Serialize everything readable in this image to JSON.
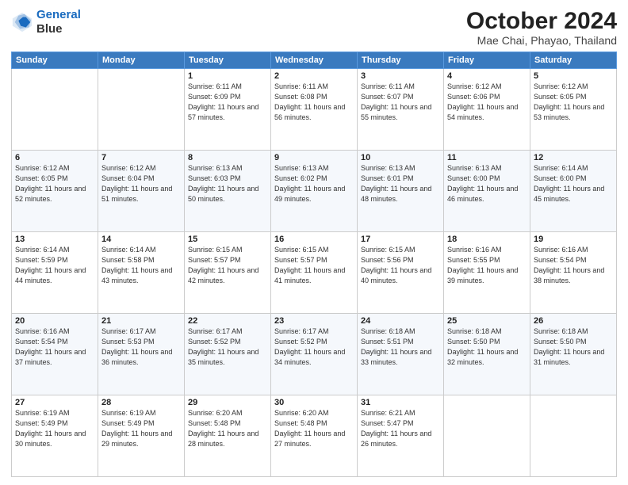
{
  "header": {
    "logo_line1": "General",
    "logo_line2": "Blue",
    "title": "October 2024",
    "subtitle": "Mae Chai, Phayao, Thailand"
  },
  "weekdays": [
    "Sunday",
    "Monday",
    "Tuesday",
    "Wednesday",
    "Thursday",
    "Friday",
    "Saturday"
  ],
  "weeks": [
    [
      {
        "day": "",
        "sunrise": "",
        "sunset": "",
        "daylight": ""
      },
      {
        "day": "",
        "sunrise": "",
        "sunset": "",
        "daylight": ""
      },
      {
        "day": "1",
        "sunrise": "Sunrise: 6:11 AM",
        "sunset": "Sunset: 6:09 PM",
        "daylight": "Daylight: 11 hours and 57 minutes."
      },
      {
        "day": "2",
        "sunrise": "Sunrise: 6:11 AM",
        "sunset": "Sunset: 6:08 PM",
        "daylight": "Daylight: 11 hours and 56 minutes."
      },
      {
        "day": "3",
        "sunrise": "Sunrise: 6:11 AM",
        "sunset": "Sunset: 6:07 PM",
        "daylight": "Daylight: 11 hours and 55 minutes."
      },
      {
        "day": "4",
        "sunrise": "Sunrise: 6:12 AM",
        "sunset": "Sunset: 6:06 PM",
        "daylight": "Daylight: 11 hours and 54 minutes."
      },
      {
        "day": "5",
        "sunrise": "Sunrise: 6:12 AM",
        "sunset": "Sunset: 6:05 PM",
        "daylight": "Daylight: 11 hours and 53 minutes."
      }
    ],
    [
      {
        "day": "6",
        "sunrise": "Sunrise: 6:12 AM",
        "sunset": "Sunset: 6:05 PM",
        "daylight": "Daylight: 11 hours and 52 minutes."
      },
      {
        "day": "7",
        "sunrise": "Sunrise: 6:12 AM",
        "sunset": "Sunset: 6:04 PM",
        "daylight": "Daylight: 11 hours and 51 minutes."
      },
      {
        "day": "8",
        "sunrise": "Sunrise: 6:13 AM",
        "sunset": "Sunset: 6:03 PM",
        "daylight": "Daylight: 11 hours and 50 minutes."
      },
      {
        "day": "9",
        "sunrise": "Sunrise: 6:13 AM",
        "sunset": "Sunset: 6:02 PM",
        "daylight": "Daylight: 11 hours and 49 minutes."
      },
      {
        "day": "10",
        "sunrise": "Sunrise: 6:13 AM",
        "sunset": "Sunset: 6:01 PM",
        "daylight": "Daylight: 11 hours and 48 minutes."
      },
      {
        "day": "11",
        "sunrise": "Sunrise: 6:13 AM",
        "sunset": "Sunset: 6:00 PM",
        "daylight": "Daylight: 11 hours and 46 minutes."
      },
      {
        "day": "12",
        "sunrise": "Sunrise: 6:14 AM",
        "sunset": "Sunset: 6:00 PM",
        "daylight": "Daylight: 11 hours and 45 minutes."
      }
    ],
    [
      {
        "day": "13",
        "sunrise": "Sunrise: 6:14 AM",
        "sunset": "Sunset: 5:59 PM",
        "daylight": "Daylight: 11 hours and 44 minutes."
      },
      {
        "day": "14",
        "sunrise": "Sunrise: 6:14 AM",
        "sunset": "Sunset: 5:58 PM",
        "daylight": "Daylight: 11 hours and 43 minutes."
      },
      {
        "day": "15",
        "sunrise": "Sunrise: 6:15 AM",
        "sunset": "Sunset: 5:57 PM",
        "daylight": "Daylight: 11 hours and 42 minutes."
      },
      {
        "day": "16",
        "sunrise": "Sunrise: 6:15 AM",
        "sunset": "Sunset: 5:57 PM",
        "daylight": "Daylight: 11 hours and 41 minutes."
      },
      {
        "day": "17",
        "sunrise": "Sunrise: 6:15 AM",
        "sunset": "Sunset: 5:56 PM",
        "daylight": "Daylight: 11 hours and 40 minutes."
      },
      {
        "day": "18",
        "sunrise": "Sunrise: 6:16 AM",
        "sunset": "Sunset: 5:55 PM",
        "daylight": "Daylight: 11 hours and 39 minutes."
      },
      {
        "day": "19",
        "sunrise": "Sunrise: 6:16 AM",
        "sunset": "Sunset: 5:54 PM",
        "daylight": "Daylight: 11 hours and 38 minutes."
      }
    ],
    [
      {
        "day": "20",
        "sunrise": "Sunrise: 6:16 AM",
        "sunset": "Sunset: 5:54 PM",
        "daylight": "Daylight: 11 hours and 37 minutes."
      },
      {
        "day": "21",
        "sunrise": "Sunrise: 6:17 AM",
        "sunset": "Sunset: 5:53 PM",
        "daylight": "Daylight: 11 hours and 36 minutes."
      },
      {
        "day": "22",
        "sunrise": "Sunrise: 6:17 AM",
        "sunset": "Sunset: 5:52 PM",
        "daylight": "Daylight: 11 hours and 35 minutes."
      },
      {
        "day": "23",
        "sunrise": "Sunrise: 6:17 AM",
        "sunset": "Sunset: 5:52 PM",
        "daylight": "Daylight: 11 hours and 34 minutes."
      },
      {
        "day": "24",
        "sunrise": "Sunrise: 6:18 AM",
        "sunset": "Sunset: 5:51 PM",
        "daylight": "Daylight: 11 hours and 33 minutes."
      },
      {
        "day": "25",
        "sunrise": "Sunrise: 6:18 AM",
        "sunset": "Sunset: 5:50 PM",
        "daylight": "Daylight: 11 hours and 32 minutes."
      },
      {
        "day": "26",
        "sunrise": "Sunrise: 6:18 AM",
        "sunset": "Sunset: 5:50 PM",
        "daylight": "Daylight: 11 hours and 31 minutes."
      }
    ],
    [
      {
        "day": "27",
        "sunrise": "Sunrise: 6:19 AM",
        "sunset": "Sunset: 5:49 PM",
        "daylight": "Daylight: 11 hours and 30 minutes."
      },
      {
        "day": "28",
        "sunrise": "Sunrise: 6:19 AM",
        "sunset": "Sunset: 5:49 PM",
        "daylight": "Daylight: 11 hours and 29 minutes."
      },
      {
        "day": "29",
        "sunrise": "Sunrise: 6:20 AM",
        "sunset": "Sunset: 5:48 PM",
        "daylight": "Daylight: 11 hours and 28 minutes."
      },
      {
        "day": "30",
        "sunrise": "Sunrise: 6:20 AM",
        "sunset": "Sunset: 5:48 PM",
        "daylight": "Daylight: 11 hours and 27 minutes."
      },
      {
        "day": "31",
        "sunrise": "Sunrise: 6:21 AM",
        "sunset": "Sunset: 5:47 PM",
        "daylight": "Daylight: 11 hours and 26 minutes."
      },
      {
        "day": "",
        "sunrise": "",
        "sunset": "",
        "daylight": ""
      },
      {
        "day": "",
        "sunrise": "",
        "sunset": "",
        "daylight": ""
      }
    ]
  ]
}
